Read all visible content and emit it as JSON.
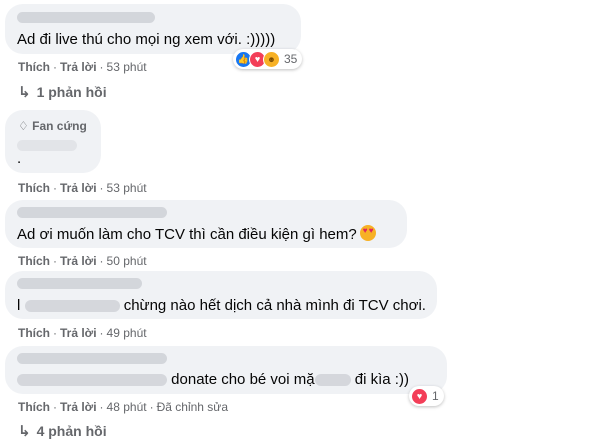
{
  "comments": [
    {
      "text": "Ad đi live thú cho mọi ng xem với. :)))))",
      "actions": {
        "like": "Thích",
        "reply": "Trả lời",
        "time": "53 phút"
      },
      "reactions": {
        "count": "35",
        "icons": [
          "like-icon",
          "love-icon",
          "haha-icon"
        ]
      },
      "replies": "1 phản hồi"
    },
    {
      "badge": "Fan cứng",
      "text": ".",
      "actions": {
        "like": "Thích",
        "reply": "Trả lời",
        "time": "53 phút"
      }
    },
    {
      "text": "Ad ơi muốn làm cho TCV thì cần điều kiện gì hem?",
      "actions": {
        "like": "Thích",
        "reply": "Trả lời",
        "time": "50 phút"
      }
    },
    {
      "text_prefix": "l",
      "text": "chừng nào hết dịch cả nhà mình đi TCV chơi.",
      "actions": {
        "like": "Thích",
        "reply": "Trả lời",
        "time": "49 phút"
      }
    },
    {
      "text_a": "donate cho bé voi mặ",
      "text_b": "đi kìa :))",
      "actions": {
        "like": "Thích",
        "reply": "Trả lời",
        "time": "48 phút",
        "edited": "Đã chỉnh sửa"
      },
      "reactions": {
        "count": "1",
        "icons": [
          "love-icon"
        ]
      },
      "replies": "4 phản hồi"
    }
  ],
  "separator": "·",
  "colors": {
    "bubble": "#f0f2f5",
    "meta": "#65676b",
    "like": "#1877f2",
    "love": "#f33e58",
    "haha": "#f7b125"
  }
}
